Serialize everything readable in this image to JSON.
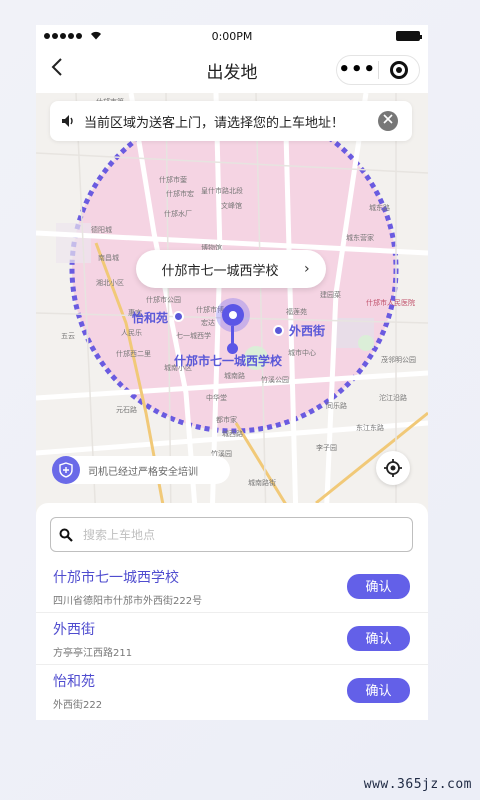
{
  "status_bar": {
    "time": "0:00PM"
  },
  "nav": {
    "back_glyph": "‹",
    "title": "出发地",
    "more_glyph": "•••"
  },
  "map": {
    "notice": "当前区域为送客上门，请选择您的上车地址！",
    "callout": "什邡市七一城西学校",
    "callout_chevron": "›",
    "poi": {
      "main": "什邡市七一城西学校",
      "waixijie": "外西街",
      "yiheyuan": "怡和苑"
    },
    "safety_text": "司机已经过严格安全培训",
    "labels": [
      "什邡市第",
      "什邡市蓥",
      "什邡市宏",
      "皇什市路北段",
      "文峰馆",
      "城东路",
      "城东营家",
      "博物馆",
      "什邡水厂",
      "什邡市人民医院",
      "德阳城",
      "南昌城",
      "五云",
      "什邡市公园",
      "竹溪公园",
      "城市中心",
      "建园菜",
      "福莲苑",
      "什邡市博",
      "城南小区",
      "人民乐",
      "湘北小区",
      "七一城西学",
      "什邡西二里",
      "城南路",
      "中华堂",
      "茂邻明公园",
      "北门",
      "惠宜",
      "元石路",
      "李子园",
      "城西路",
      "东江东路",
      "同乐路",
      "城南路街",
      "竹溪园",
      "都市家",
      "沱江沿路",
      "宏达"
    ]
  },
  "search": {
    "placeholder": "搜索上车地点"
  },
  "locations": [
    {
      "name": "什邡市七一城西学校",
      "address": "四川省德阳市什邡市外西街222号",
      "button": "确认"
    },
    {
      "name": "外西街",
      "address": "方亭亭江西路211",
      "button": "确认"
    },
    {
      "name": "怡和苑",
      "address": "外西街222",
      "button": "确认"
    }
  ],
  "watermark": "www.365jz.com",
  "colors": {
    "accent": "#5b56e6",
    "zone_fill": "#f2cfe0",
    "zone_border": "#6a5be0"
  }
}
